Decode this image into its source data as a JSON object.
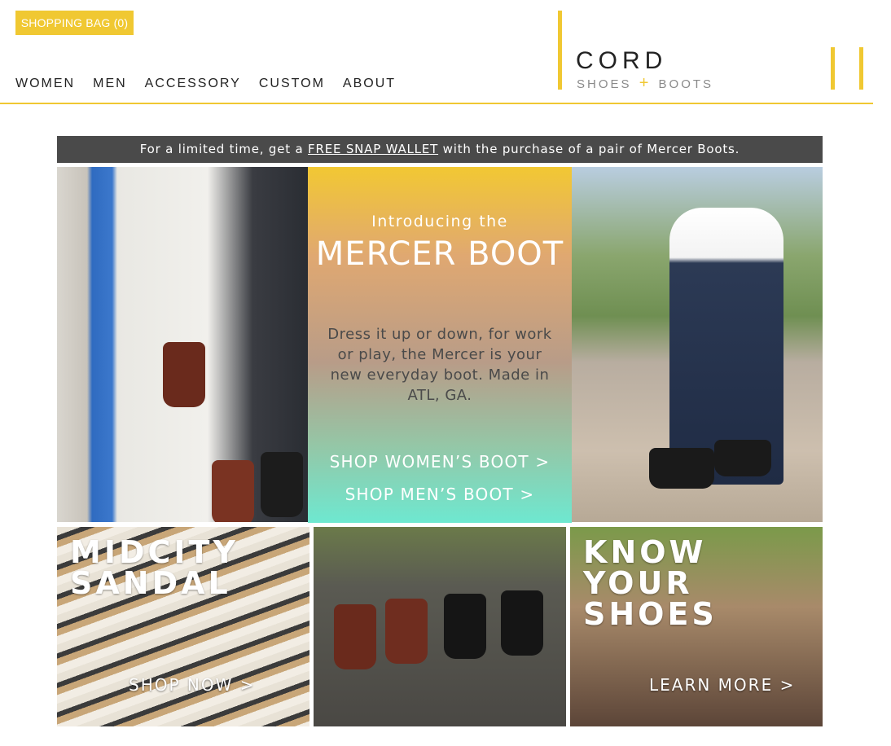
{
  "header": {
    "shopping_bag": "SHOPPING BAG (0)",
    "nav": [
      "WOMEN",
      "MEN",
      "ACCESSORY",
      "CUSTOM",
      "ABOUT"
    ],
    "logo_title": "CORD",
    "logo_sub_left": "SHOES",
    "logo_sub_plus": "+",
    "logo_sub_right": "BOOTS"
  },
  "promo": {
    "prefix": "For a limited time, get a",
    "link": "FREE SNAP WALLET",
    "suffix": "with the purchase of a pair of Mercer Boots."
  },
  "hero": {
    "intro": "Introducing the",
    "title": "MERCER BOOT",
    "description": "Dress it up or down, for work or play, the Mercer is your new everyday boot. Made in ATL, GA.",
    "shop_women": "SHOP WOMEN’S BOOT >",
    "shop_men": "SHOP MEN’S BOOT >"
  },
  "tiles": {
    "sandal_title_1": "MIDCITY",
    "sandal_title_2": "SANDAL",
    "sandal_link": "SHOP NOW >",
    "know_title_1": "KNOW",
    "know_title_2": "YOUR",
    "know_title_3": "SHOES",
    "know_link": "LEARN MORE >"
  },
  "colors": {
    "accent": "#f0c832",
    "promo_bg": "#4a4a4a",
    "gradient_top": "#f2c833",
    "gradient_bottom": "#6ee8d0"
  }
}
